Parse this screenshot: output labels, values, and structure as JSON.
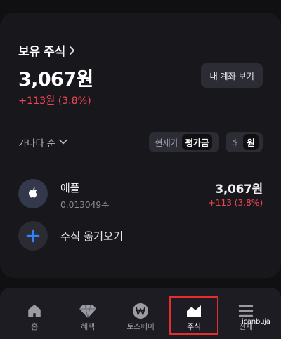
{
  "holdings": {
    "title": "보유 주식",
    "total_amount": "3,067원",
    "total_change": "+113원 (3.8%)",
    "account_button": "내 계좌 보기"
  },
  "controls": {
    "sort_label": "가나다 순",
    "view_toggle": {
      "options": [
        "현재가",
        "평가금"
      ],
      "selected": "평가금"
    },
    "currency_toggle": {
      "options": [
        "$",
        "원"
      ],
      "selected": "원"
    }
  },
  "stocks": [
    {
      "name": "애플",
      "quantity": "0.013049주",
      "value": "3,067원",
      "change": "+113 (3.8%)",
      "icon": "apple-logo-icon"
    }
  ],
  "transfer": {
    "label": "주식 옮겨오기",
    "icon": "plus-icon"
  },
  "tabbar": {
    "items": [
      {
        "label": "홈",
        "icon": "home-icon"
      },
      {
        "label": "혜택",
        "icon": "diamond-icon"
      },
      {
        "label": "토스페이",
        "icon": "won-coin-icon"
      },
      {
        "label": "주식",
        "icon": "stock-chart-icon"
      },
      {
        "label": "전체",
        "icon": "menu-icon"
      }
    ],
    "active": "주식"
  },
  "watermark": "icanbuja",
  "colors": {
    "background": "#101013",
    "card": "#17171c",
    "positive_change": "#f04452",
    "plus_icon": "#3182f6",
    "highlight_box": "#e52d2d"
  }
}
